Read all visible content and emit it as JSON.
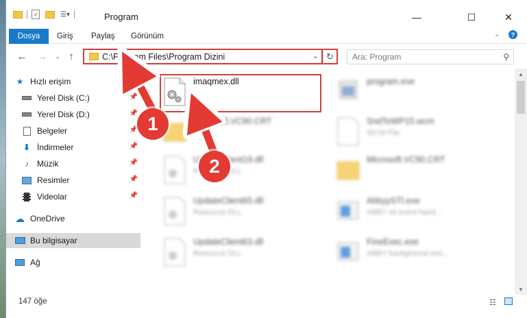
{
  "window": {
    "title": "Program"
  },
  "ribbon": {
    "tabs": [
      "Dosya",
      "Giriş",
      "Paylaş",
      "Görünüm"
    ]
  },
  "address": {
    "path": "C:\\Program Files\\Program Dizini"
  },
  "search": {
    "placeholder": "Ara: Program"
  },
  "sidebar": {
    "items": [
      {
        "label": "Hızlı erişim",
        "icon": "star-icon"
      },
      {
        "label": "Yerel Disk (C:)",
        "icon": "drive-icon"
      },
      {
        "label": "Yerel Disk (D:)",
        "icon": "drive-icon"
      },
      {
        "label": "Belgeler",
        "icon": "documents-icon"
      },
      {
        "label": "İndirmeler",
        "icon": "download-icon"
      },
      {
        "label": "Müzik",
        "icon": "music-icon"
      },
      {
        "label": "Resimler",
        "icon": "pictures-icon"
      },
      {
        "label": "Videolar",
        "icon": "videos-icon"
      },
      {
        "label": "OneDrive",
        "icon": "cloud-icon"
      },
      {
        "label": "Bu bilgisayar",
        "icon": "computer-icon"
      },
      {
        "label": "Ağ",
        "icon": "network-icon"
      }
    ]
  },
  "files": [
    {
      "name": "imaqmex.dll",
      "desc": ""
    },
    {
      "name": "program.exe",
      "desc": ""
    },
    {
      "name": "Microsoft.VC90.CRT",
      "desc": ""
    },
    {
      "name": "SndToWP15.wcm",
      "desc": "WCM File"
    },
    {
      "name": "UpdateClient19.dll",
      "desc": "Resource DLL"
    },
    {
      "name": "Microsoft.VC90.CRT",
      "desc": ""
    },
    {
      "name": "UpdateClient65.dll",
      "desc": "Resource DLL"
    },
    {
      "name": "AbbyySTI.exe",
      "desc": "ABBY sti event hand..."
    },
    {
      "name": "UpdateClient63.dll",
      "desc": "Resource DLL"
    },
    {
      "name": "FineExec.exe",
      "desc": "ABBY background exe..."
    }
  ],
  "status": {
    "count": "147 öğe"
  },
  "markers": [
    "1",
    "2"
  ],
  "colors": {
    "accent": "#1979ca",
    "highlight": "#d63b3b",
    "marker": "#e33a34"
  }
}
